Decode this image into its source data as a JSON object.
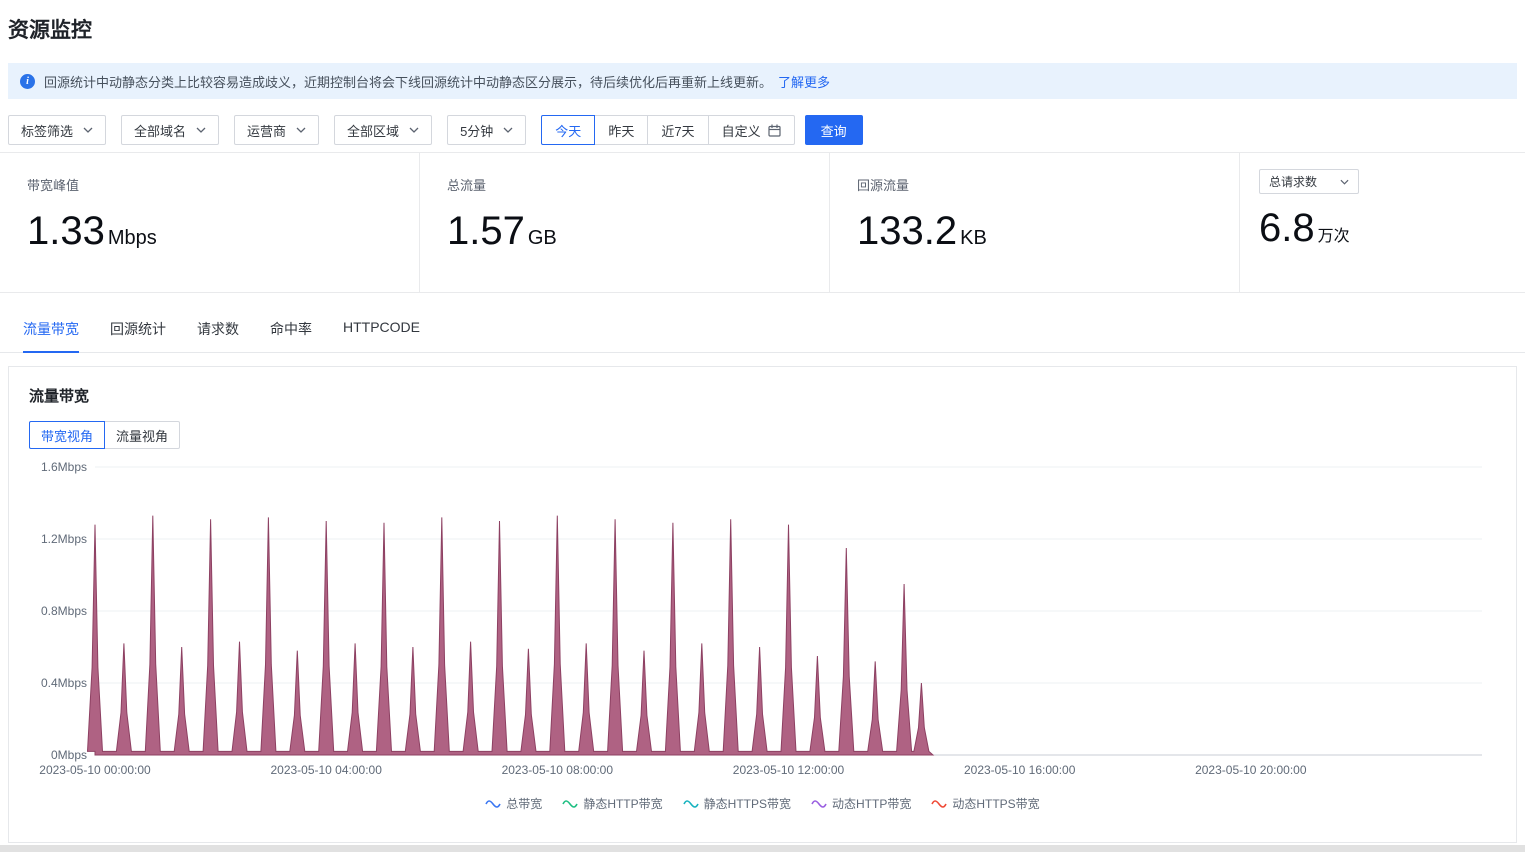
{
  "page": {
    "title": "资源监控"
  },
  "banner": {
    "text": "回源统计中动静态分类上比较容易造成歧义，近期控制台将会下线回源统计中动静态区分展示，待后续优化后再重新上线更新。",
    "link": "了解更多"
  },
  "filters": {
    "tag": "标签筛选",
    "domain": "全部域名",
    "isp": "运营商",
    "region": "全部区域",
    "granularity": "5分钟",
    "time_ranges": [
      "今天",
      "昨天",
      "近7天",
      "自定义"
    ],
    "active_time_range": "今天",
    "query": "查询"
  },
  "stats": [
    {
      "label": "带宽峰值",
      "value": "1.33",
      "unit": "Mbps"
    },
    {
      "label": "总流量",
      "value": "1.57",
      "unit": "GB"
    },
    {
      "label": "回源流量",
      "value": "133.2",
      "unit": "KB"
    },
    {
      "label": "总请求数",
      "value": "6.8",
      "unit": "万次"
    }
  ],
  "tabs": [
    "流量带宽",
    "回源统计",
    "请求数",
    "命中率",
    "HTTPCODE"
  ],
  "active_tab": "流量带宽",
  "chart_section": {
    "title": "流量带宽",
    "views": [
      "带宽视角",
      "流量视角"
    ],
    "active_view": "带宽视角"
  },
  "chart_data": {
    "type": "area",
    "title": "流量带宽",
    "unit": "Mbps",
    "ylim": [
      0,
      1.6
    ],
    "yticks": [
      0,
      0.4,
      0.8,
      1.2,
      1.6
    ],
    "ytick_labels": [
      "0Mbps",
      "0.4Mbps",
      "0.8Mbps",
      "1.2Mbps",
      "1.6Mbps"
    ],
    "x_hours": [
      0,
      24
    ],
    "xtick_hours": [
      0,
      4,
      8,
      12,
      16,
      20
    ],
    "xtick_labels": [
      "2023-05-10 00:00:00",
      "2023-05-10 04:00:00",
      "2023-05-10 08:00:00",
      "2023-05-10 12:00:00",
      "2023-05-10 16:00:00",
      "2023-05-10 20:00:00"
    ],
    "series_name": "总带宽",
    "area_color": "#a85578",
    "line_color": "#8d4062",
    "baseline_mbps": 0.02,
    "data_end_hour": 14.5,
    "peaks_hour_mbps": [
      [
        0,
        1.28
      ],
      [
        0.5,
        0.62
      ],
      [
        1,
        1.33
      ],
      [
        1.5,
        0.6
      ],
      [
        2,
        1.31
      ],
      [
        2.5,
        0.63
      ],
      [
        3,
        1.32
      ],
      [
        3.5,
        0.58
      ],
      [
        4,
        1.3
      ],
      [
        4.5,
        0.62
      ],
      [
        5,
        1.29
      ],
      [
        5.5,
        0.6
      ],
      [
        6,
        1.32
      ],
      [
        6.5,
        0.63
      ],
      [
        7,
        1.3
      ],
      [
        7.5,
        0.59
      ],
      [
        8,
        1.33
      ],
      [
        8.5,
        0.62
      ],
      [
        9,
        1.31
      ],
      [
        9.5,
        0.58
      ],
      [
        10,
        1.29
      ],
      [
        10.5,
        0.62
      ],
      [
        11,
        1.31
      ],
      [
        11.5,
        0.6
      ],
      [
        12,
        1.28
      ],
      [
        12.5,
        0.55
      ],
      [
        13,
        1.15
      ],
      [
        13.5,
        0.52
      ],
      [
        14,
        0.95
      ],
      [
        14.3,
        0.4
      ]
    ],
    "grid": "horizontal",
    "legend_position": "bottom",
    "legend": [
      {
        "label": "总带宽",
        "color": "#3b77f2"
      },
      {
        "label": "静态HTTP带宽",
        "color": "#1fbf83"
      },
      {
        "label": "静态HTTPS带宽",
        "color": "#17b3bf"
      },
      {
        "label": "动态HTTP带宽",
        "color": "#9a5fe0"
      },
      {
        "label": "动态HTTPS带宽",
        "color": "#ef4a37"
      }
    ]
  }
}
